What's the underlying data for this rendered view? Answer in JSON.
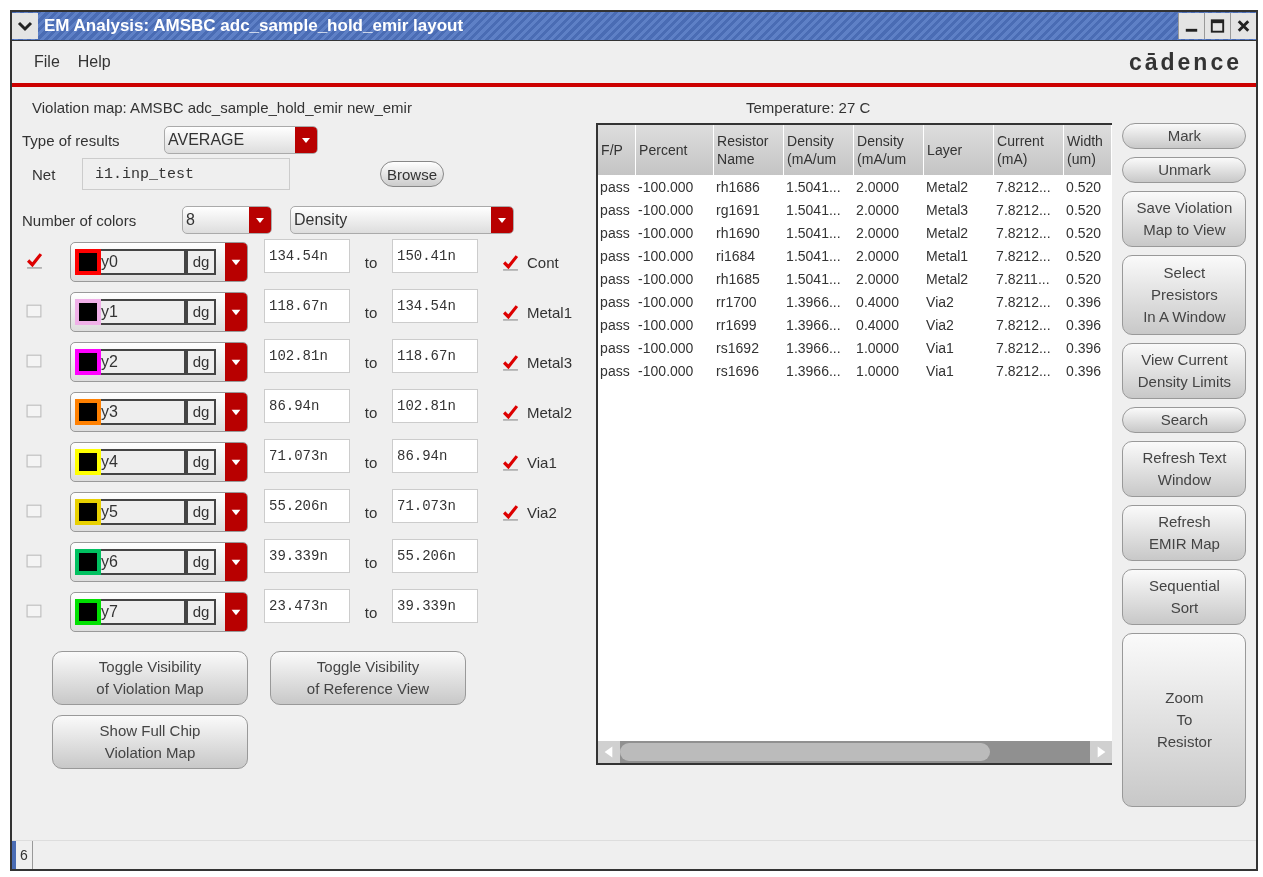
{
  "window": {
    "title": "EM Analysis: AMSBC adc_sample_hold_emir layout"
  },
  "menu": [
    "File",
    "Help"
  ],
  "logo": "cādence",
  "violation_map": "Violation map: AMSBC adc_sample_hold_emir new_emir",
  "temperature": "Temperature: 27 C",
  "type_of_results": {
    "label": "Type of results",
    "value": "AVERAGE"
  },
  "net": {
    "label": "Net",
    "value": "i1.inp_test",
    "browse": "Browse"
  },
  "number_of_colors": {
    "label": "Number of colors",
    "value": "8",
    "mode": "Density"
  },
  "colors": [
    {
      "checked": true,
      "color": "#ff0000",
      "name": "y0",
      "tag": "dg",
      "from": "134.54n",
      "to_word": "to",
      "to": "150.41n",
      "layer": {
        "checked": true,
        "label": "Cont"
      }
    },
    {
      "checked": false,
      "color": "#f0b0e8",
      "name": "y1",
      "tag": "dg",
      "from": "118.67n",
      "to_word": "to",
      "to": "134.54n",
      "layer": {
        "checked": true,
        "label": "Metal1"
      }
    },
    {
      "checked": false,
      "color": "#ff00ff",
      "name": "y2",
      "tag": "dg",
      "from": "102.81n",
      "to_word": "to",
      "to": "118.67n",
      "layer": {
        "checked": true,
        "label": "Metal3"
      }
    },
    {
      "checked": false,
      "color": "#ff8000",
      "name": "y3",
      "tag": "dg",
      "from": "86.94n",
      "to_word": "to",
      "to": "102.81n",
      "layer": {
        "checked": true,
        "label": "Metal2"
      }
    },
    {
      "checked": false,
      "color": "#ffff00",
      "name": "y4",
      "tag": "dg",
      "from": "71.073n",
      "to_word": "to",
      "to": "86.94n",
      "layer": {
        "checked": true,
        "label": "Via1"
      }
    },
    {
      "checked": false,
      "color": "#e8d000",
      "name": "y5",
      "tag": "dg",
      "from": "55.206n",
      "to_word": "to",
      "to": "71.073n",
      "layer": {
        "checked": true,
        "label": "Via2"
      }
    },
    {
      "checked": false,
      "color": "#00c060",
      "name": "y6",
      "tag": "dg",
      "from": "39.339n",
      "to_word": "to",
      "to": "55.206n"
    },
    {
      "checked": false,
      "color": "#00e000",
      "name": "y7",
      "tag": "dg",
      "from": "23.473n",
      "to_word": "to",
      "to": "39.339n"
    }
  ],
  "left_buttons": [
    "Toggle Visibility\nof Violation Map",
    "Toggle Visibility\nof Reference View",
    "Show Full Chip\nViolation Map"
  ],
  "table": {
    "columns": [
      "F/P",
      "Percent",
      "Resistor\nName",
      "Density\n(mA/um",
      "Density\n(mA/um",
      "Layer",
      "Current\n(mA)",
      "Width\n(um)"
    ],
    "rows": [
      [
        "pass",
        "-100.000",
        "rh1686",
        "1.5041...",
        "2.0000",
        "Metal2",
        "7.8212...",
        "0.520"
      ],
      [
        "pass",
        "-100.000",
        "rg1691",
        "1.5041...",
        "2.0000",
        "Metal3",
        "7.8212...",
        "0.520"
      ],
      [
        "pass",
        "-100.000",
        "rh1690",
        "1.5041...",
        "2.0000",
        "Metal2",
        "7.8212...",
        "0.520"
      ],
      [
        "pass",
        "-100.000",
        "ri1684",
        "1.5041...",
        "2.0000",
        "Metal1",
        "7.8212...",
        "0.520"
      ],
      [
        "pass",
        "-100.000",
        "rh1685",
        "1.5041...",
        "2.0000",
        "Metal2",
        "7.8211...",
        "0.520"
      ],
      [
        "pass",
        "-100.000",
        "rr1700",
        "1.3966...",
        "0.4000",
        "Via2",
        "7.8212...",
        "0.396"
      ],
      [
        "pass",
        "-100.000",
        "rr1699",
        "1.3966...",
        "0.4000",
        "Via2",
        "7.8212...",
        "0.396"
      ],
      [
        "pass",
        "-100.000",
        "rs1692",
        "1.3966...",
        "1.0000",
        "Via1",
        "7.8212...",
        "0.396"
      ],
      [
        "pass",
        "-100.000",
        "rs1696",
        "1.3966...",
        "1.0000",
        "Via1",
        "7.8212...",
        "0.396"
      ]
    ]
  },
  "right_buttons": [
    {
      "label": "Mark",
      "kind": "small"
    },
    {
      "label": "Unmark",
      "kind": "small"
    },
    {
      "label": "Save Violation\nMap to View",
      "kind": "medium"
    },
    {
      "label": "Select\nPresistors\nIn A Window",
      "kind": "medium"
    },
    {
      "label": "View Current\nDensity Limits",
      "kind": "medium"
    },
    {
      "label": "Search",
      "kind": "small"
    },
    {
      "label": "Refresh Text\nWindow",
      "kind": "medium"
    },
    {
      "label": "Refresh\nEMIR Map",
      "kind": "medium"
    },
    {
      "label": "Sequential\nSort",
      "kind": "medium"
    },
    {
      "label": "Zoom\nTo\nResistor",
      "kind": "large"
    }
  ],
  "status_bar": "6"
}
